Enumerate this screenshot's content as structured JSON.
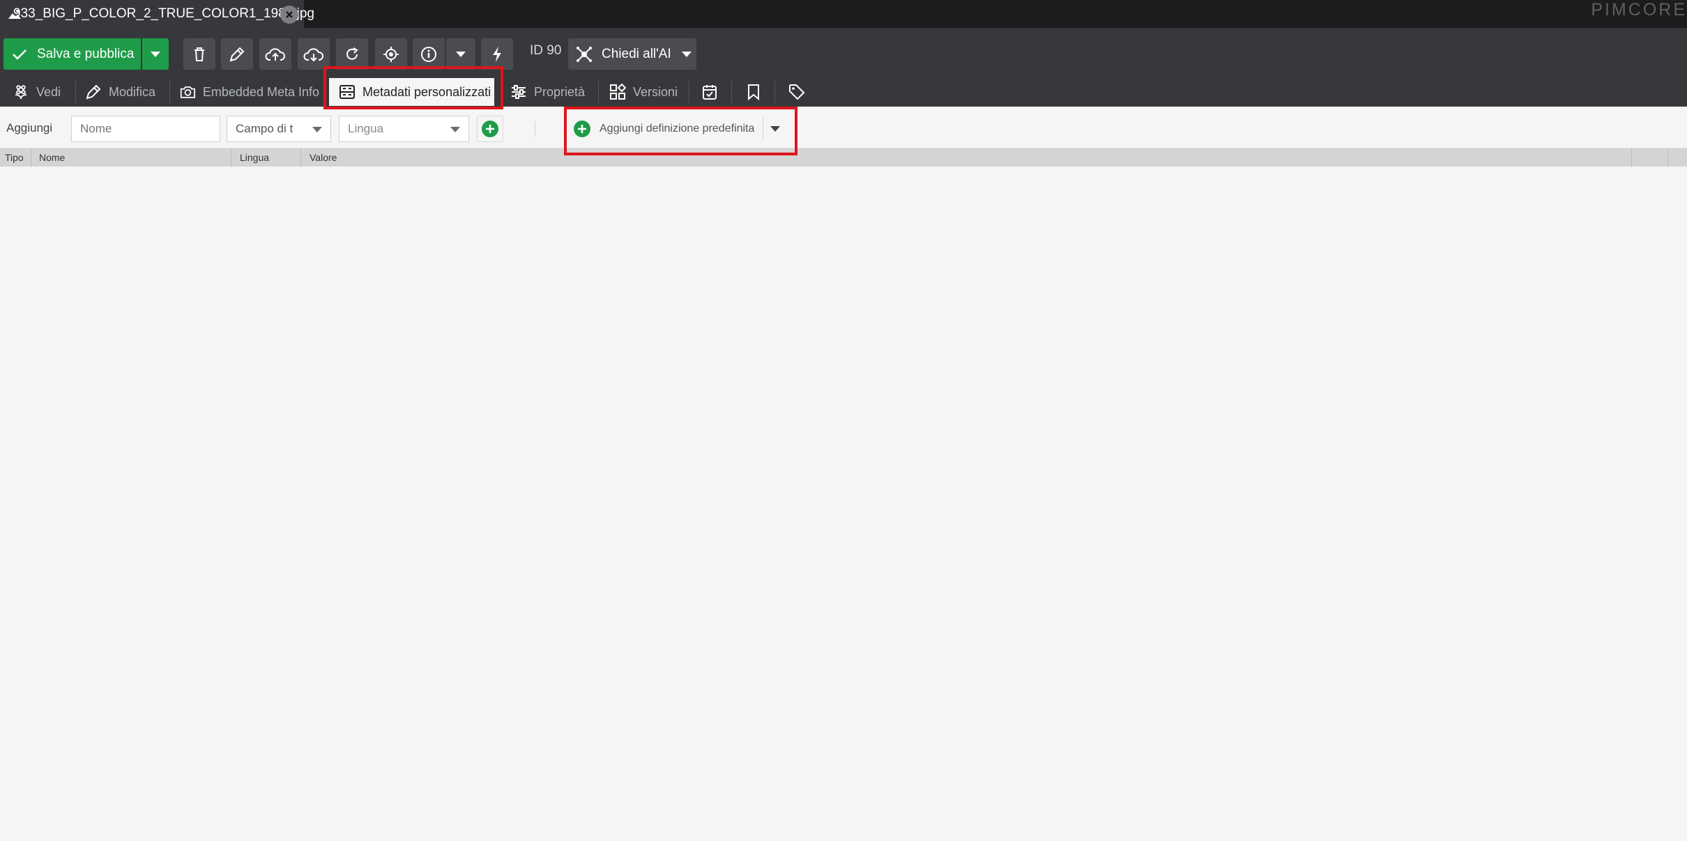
{
  "tab": {
    "title": "933_BIG_P_COLOR_2_TRUE_COLOR1_1980.jpg"
  },
  "brand": "PIMCORE",
  "toolbar": {
    "save_label": "Salva e pubblica",
    "id_label": "ID 90",
    "ai_label": "Chiedi all'AI"
  },
  "subtabs": [
    {
      "label": "Vedi",
      "icon": "flower-icon"
    },
    {
      "label": "Modifica",
      "icon": "pencil-icon"
    },
    {
      "label": "Embedded Meta Info",
      "icon": "camera-icon"
    },
    {
      "label": "Metadati personalizzati",
      "icon": "metadata-icon",
      "active": true
    },
    {
      "label": "Proprietà",
      "icon": "sliders-icon"
    },
    {
      "label": "Versioni",
      "icon": "versions-icon"
    }
  ],
  "addbar": {
    "label": "Aggiungi",
    "name_placeholder": "Nome",
    "type_value": "Campo di t",
    "language_placeholder": "Lingua",
    "predefined_label": "Aggiungi definizione predefinita"
  },
  "grid": {
    "columns": [
      "Tipo",
      "Nome",
      "Lingua",
      "Valore"
    ]
  },
  "colors": {
    "accent_green": "#1f9c49",
    "toolbar_bg": "#36383b",
    "highlight_red": "#e0141b"
  }
}
